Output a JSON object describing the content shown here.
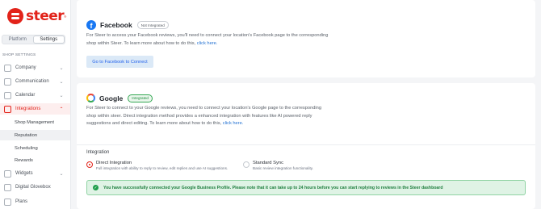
{
  "brand": {
    "name": "steer",
    "reg": "®"
  },
  "view_toggle": {
    "platform": "Platform",
    "settings": "Settings"
  },
  "sidebar": {
    "section_label": "SHOP SETTINGS",
    "items": [
      {
        "label": "Company",
        "icon": "building-icon"
      },
      {
        "label": "Communication",
        "icon": "megaphone-icon"
      },
      {
        "label": "Calendar",
        "icon": "calendar-icon"
      },
      {
        "label": "Integrations",
        "icon": "grid-icon",
        "expanded": true
      },
      {
        "label": "Widgets",
        "icon": "widget-icon"
      },
      {
        "label": "Digital Glovebox",
        "icon": "glovebox-icon"
      },
      {
        "label": "Plans",
        "icon": "document-icon"
      }
    ],
    "sub_items": [
      {
        "label": "Shop Management"
      },
      {
        "label": "Reputation",
        "selected": true
      },
      {
        "label": "Scheduling"
      },
      {
        "label": "Rewards"
      }
    ]
  },
  "facebook": {
    "name": "Facebook",
    "status": "Not Integrated",
    "desc_line1": "For Steer to access your Facebook reviews, you'll need to connect your location's Facebook page to the corresponding",
    "desc_line2": "shop within Steer. To learn more about how to do this, ",
    "link": "click here.",
    "button": "Go to Facebook to Connect"
  },
  "google": {
    "name": "Google",
    "status": "Integrated",
    "desc_line1": "For Steer to connect to your Google reviews, you need to connect your location's Google page to the corresponding",
    "desc_line2": "shop within steer. Direct integration method provides a enhanced integration with features like AI powered reply",
    "desc_line3": "suggestions and direct editing. To learn more about how to do this, ",
    "link": "click here.",
    "integration_heading": "Integration",
    "options": [
      {
        "title": "Direct Integration",
        "sub": "Full integration with ability to reply to review, edit replies and use AI suggestions.",
        "selected": true
      },
      {
        "title": "Standard Sync",
        "sub": "Basic review integration functionality.",
        "selected": false
      }
    ],
    "success": "You have successfully connected your Google Business Profile. Please note that it can take up to 24 hours before you can start replying to reviews in the Steer dashboard"
  },
  "colors": {
    "accent": "#e2231a",
    "link": "#1f6fd1",
    "success": "#1e9e4a"
  }
}
